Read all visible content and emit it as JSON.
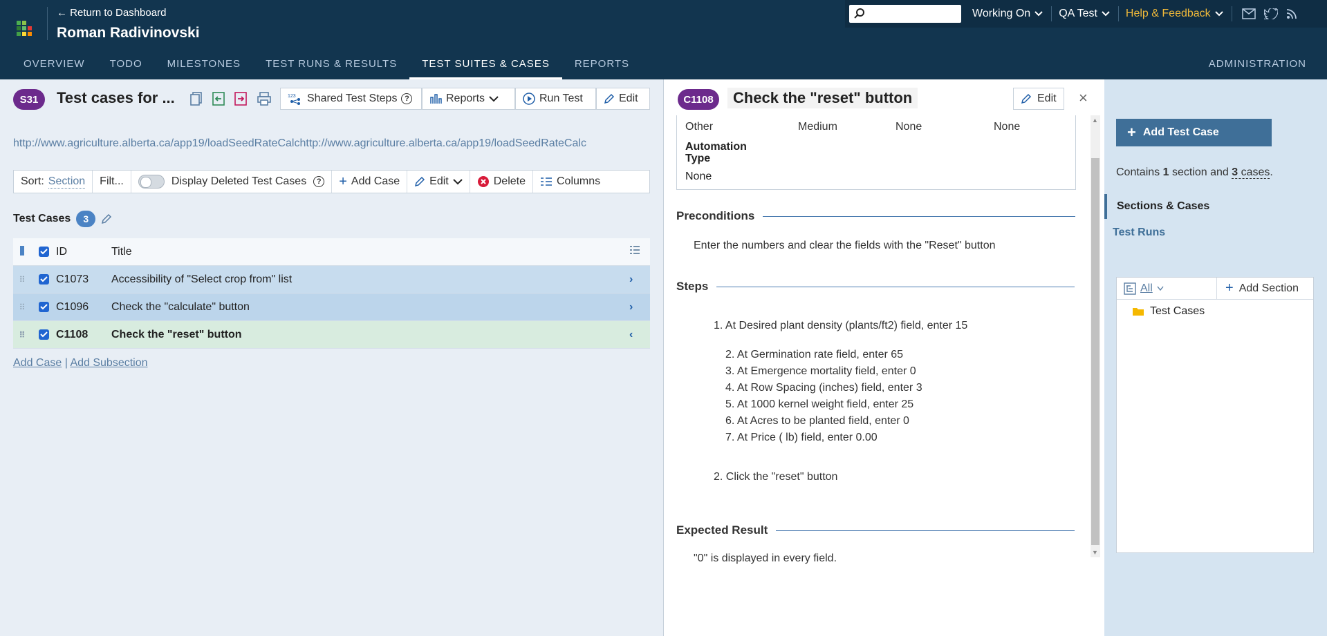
{
  "header": {
    "return_link": "← Return to Dashboard",
    "user_name": "Roman Radivinovski",
    "search_placeholder": "",
    "working_on": "Working On",
    "project": "QA Test",
    "help": "Help & Feedback",
    "tabs": [
      "OVERVIEW",
      "TODO",
      "MILESTONES",
      "TEST RUNS & RESULTS",
      "TEST SUITES & CASES",
      "REPORTS"
    ],
    "active_tab": "TEST SUITES & CASES",
    "admin": "ADMINISTRATION",
    "colors": {
      "bg": "#12354f",
      "accent": "#f0b93a"
    }
  },
  "suite": {
    "badge": "S31",
    "title": "Test cases for ...",
    "shared_steps": "Shared Test Steps",
    "reports": "Reports",
    "run_test": "Run Test",
    "edit": "Edit",
    "url": "http://www.agriculture.alberta.ca/app19/loadSeedRateCalchttp://www.agriculture.alberta.ca/app19/loadSeedRateCalc"
  },
  "sortbar": {
    "sort_label": "Sort:",
    "sort_value": "Section",
    "filter": "Filt...",
    "deleted": "Display Deleted Test Cases",
    "add_case": "Add Case",
    "edit": "Edit",
    "delete": "Delete",
    "columns": "Columns"
  },
  "cases": {
    "header": "Test Cases",
    "count": "3",
    "col_id": "ID",
    "col_title": "Title",
    "rows": [
      {
        "id": "C1073",
        "title": "Accessibility of \"Select crop from\" list"
      },
      {
        "id": "C1096",
        "title": "Check the \"calculate\" button"
      },
      {
        "id": "C1108",
        "title": "Check the \"reset\" button"
      }
    ],
    "add_case": "Add Case",
    "separator": "|",
    "add_subsection": "Add Subsection"
  },
  "detail": {
    "badge": "C1108",
    "title": "Check the \"reset\" button",
    "edit": "Edit",
    "close": "×",
    "fields": {
      "v1": "Other",
      "v2": "Medium",
      "v3": "None",
      "v4": "None",
      "automation_label": "Automation Type",
      "automation_value": "None"
    },
    "preconditions_h": "Preconditions",
    "preconditions": "Enter the numbers and clear the fields with the \"Reset\" button",
    "steps_h": "Steps",
    "step1": "1. At Desired plant density (plants/ft2) field, enter 15",
    "substeps": [
      "2. At Germination rate field, enter 65",
      "3. At Emergence mortality field, enter 0",
      "4. At Row Spacing (inches) field, enter 3",
      "5. At 1000 kernel weight field, enter 25",
      "6. At Acres to be planted field, enter 0",
      "7. At Price ( lb) field, enter 0.00"
    ],
    "step2": "2. Click the \"reset\" button",
    "expected_h": "Expected Result",
    "expected": "\"0\" is displayed in every field."
  },
  "sidebar": {
    "add_test_case": "Add Test Case",
    "contains_1": "Contains",
    "sections_n": "1",
    "contains_2": "section and",
    "cases_n": "3",
    "cases_word": "cases",
    "period": ".",
    "sections_cases": "Sections & Cases",
    "test_runs": "Test Runs",
    "filter_all": "All",
    "add_section": "Add Section",
    "node": "Test Cases"
  }
}
